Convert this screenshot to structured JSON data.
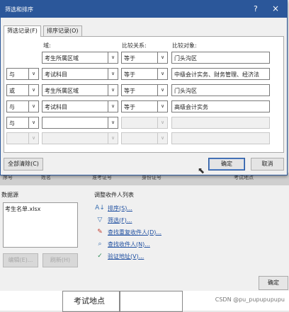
{
  "dialog": {
    "title": "筛选和排序",
    "help": "?",
    "close": "×",
    "tabs": [
      "筛选记录(F)",
      "排序记录(O)"
    ],
    "headers": {
      "field": "域:",
      "comparison": "比较关系:",
      "compare_to": "比较对象:"
    },
    "rows": [
      {
        "conj": "",
        "field": "考生所属区域",
        "comp": "等于",
        "value": "门头沟区"
      },
      {
        "conj": "与",
        "field": "考试科目",
        "comp": "等于",
        "value": "中级会计实务、财务管理、经济法"
      },
      {
        "conj": "或",
        "field": "考生所属区域",
        "comp": "等于",
        "value": "门头沟区"
      },
      {
        "conj": "与",
        "field": "考试科目",
        "comp": "等于",
        "value": "高级会计实务"
      },
      {
        "conj": "与",
        "field": "",
        "comp": "",
        "value": ""
      },
      {
        "conj": "",
        "field": "",
        "comp": "",
        "value": ""
      }
    ],
    "clear_all": "全部清除(C)",
    "ok": "确定",
    "cancel": "取消"
  },
  "back_dialog": {
    "strip": [
      "序号",
      "姓名",
      "准考证号",
      "身份证号",
      "考试地点"
    ],
    "source_label": "数据源",
    "sources": [
      "考生名单.xlsx"
    ],
    "edit_btn": "编辑(E)...",
    "refresh_btn": "刷新(H)",
    "adjust_label": "调整收件人列表",
    "actions": [
      {
        "icon": "sort-icon",
        "glyph": "A↓",
        "label": "排序(S)..."
      },
      {
        "icon": "filter-icon",
        "glyph": "▽",
        "label": "筛选(F)..."
      },
      {
        "icon": "duplicate-icon",
        "glyph": "✎",
        "label": "查找重复收件人(D)..."
      },
      {
        "icon": "find-icon",
        "glyph": "⌕",
        "label": "查找收件人(N)..."
      },
      {
        "icon": "validate-icon",
        "glyph": "✓",
        "label": "验证地址(V)..."
      }
    ],
    "ok": "确定"
  },
  "document": {
    "cell_text": "考试地点"
  },
  "watermark": "CSDN @pu_pupupupupu"
}
